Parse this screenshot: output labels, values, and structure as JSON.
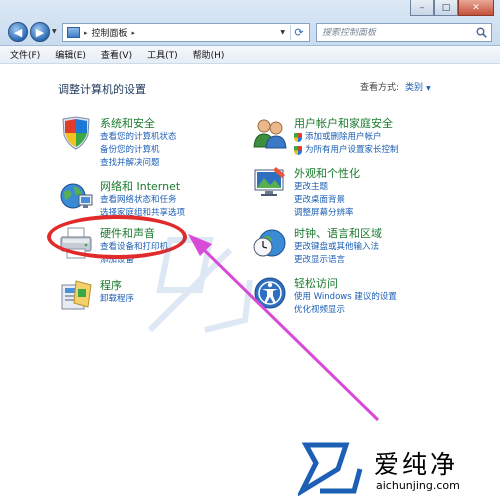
{
  "window": {
    "minimize_icon": "minimize-icon",
    "maximize_icon": "maximize-icon",
    "close_icon": "close-icon",
    "min_label": "–",
    "max_label": "□",
    "close_label": "✕"
  },
  "address": {
    "crumb": "控制面板",
    "sep": "▸",
    "sep_after": "▸"
  },
  "search": {
    "placeholder": "搜索控制面板"
  },
  "menu": {
    "file": "文件(F)",
    "edit": "编辑(E)",
    "view": "查看(V)",
    "tools": "工具(T)",
    "help": "帮助(H)"
  },
  "content": {
    "heading": "调整计算机的设置",
    "viewby_label": "查看方式:",
    "viewby_value": "类别",
    "viewby_arrow": "▼"
  },
  "categories": {
    "system": {
      "title": "系统和安全",
      "links": [
        "查看您的计算机状态",
        "备份您的计算机",
        "查找并解决问题"
      ]
    },
    "network": {
      "title": "网络和 Internet",
      "links": [
        "查看网络状态和任务",
        "选择家庭组和共享选项"
      ]
    },
    "hardware": {
      "title": "硬件和声音",
      "links": [
        "查看设备和打印机",
        "添加设备"
      ]
    },
    "programs": {
      "title": "程序",
      "links": [
        "卸载程序"
      ]
    },
    "users": {
      "title": "用户帐户和家庭安全",
      "links": [
        "添加或删除用户帐户",
        "为所有用户设置家长控制"
      ]
    },
    "appearance": {
      "title": "外观和个性化",
      "links": [
        "更改主题",
        "更改桌面背景",
        "调整屏幕分辨率"
      ]
    },
    "clock": {
      "title": "时钟、语言和区域",
      "links": [
        "更改键盘或其他输入法",
        "更改显示语言"
      ]
    },
    "ease": {
      "title": "轻松访问",
      "links": [
        "使用 Windows 建议的设置",
        "优化视频显示"
      ]
    }
  },
  "watermark": {
    "title": "爱纯净",
    "url": "aichunjing.com"
  },
  "colors": {
    "annotation_red": "#e22a2a",
    "annotation_magenta": "#d84ad8",
    "category_green": "#1a7a2e",
    "link_blue": "#1c5fb5"
  }
}
